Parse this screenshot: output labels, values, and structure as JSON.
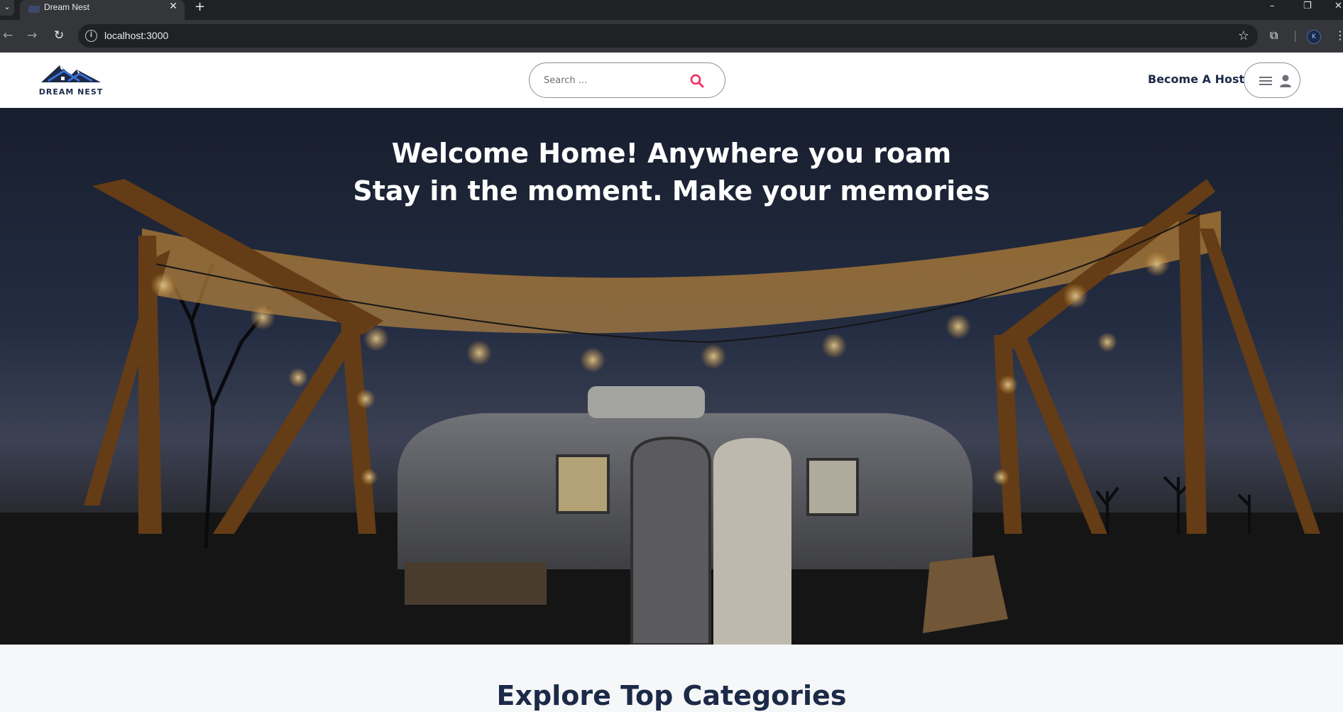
{
  "browser": {
    "tab_title": "Dream Nest",
    "tab_close": "✕",
    "new_tab": "+",
    "url": "localhost:3000",
    "profile_initials": "K"
  },
  "navbar": {
    "brand": "DREAM NEST",
    "search_placeholder": "Search ...",
    "become_host": "Become A Host"
  },
  "hero": {
    "headline_line1": "Welcome Home! Anywhere you roam",
    "headline_line2": "Stay in the moment. Make your memories"
  },
  "sections": {
    "categories_title": "Explore Top Categories"
  },
  "colors": {
    "brand_navy": "#1c2a48",
    "search_accent": "#f2295b",
    "logo_blue": "#3b6fd4"
  }
}
